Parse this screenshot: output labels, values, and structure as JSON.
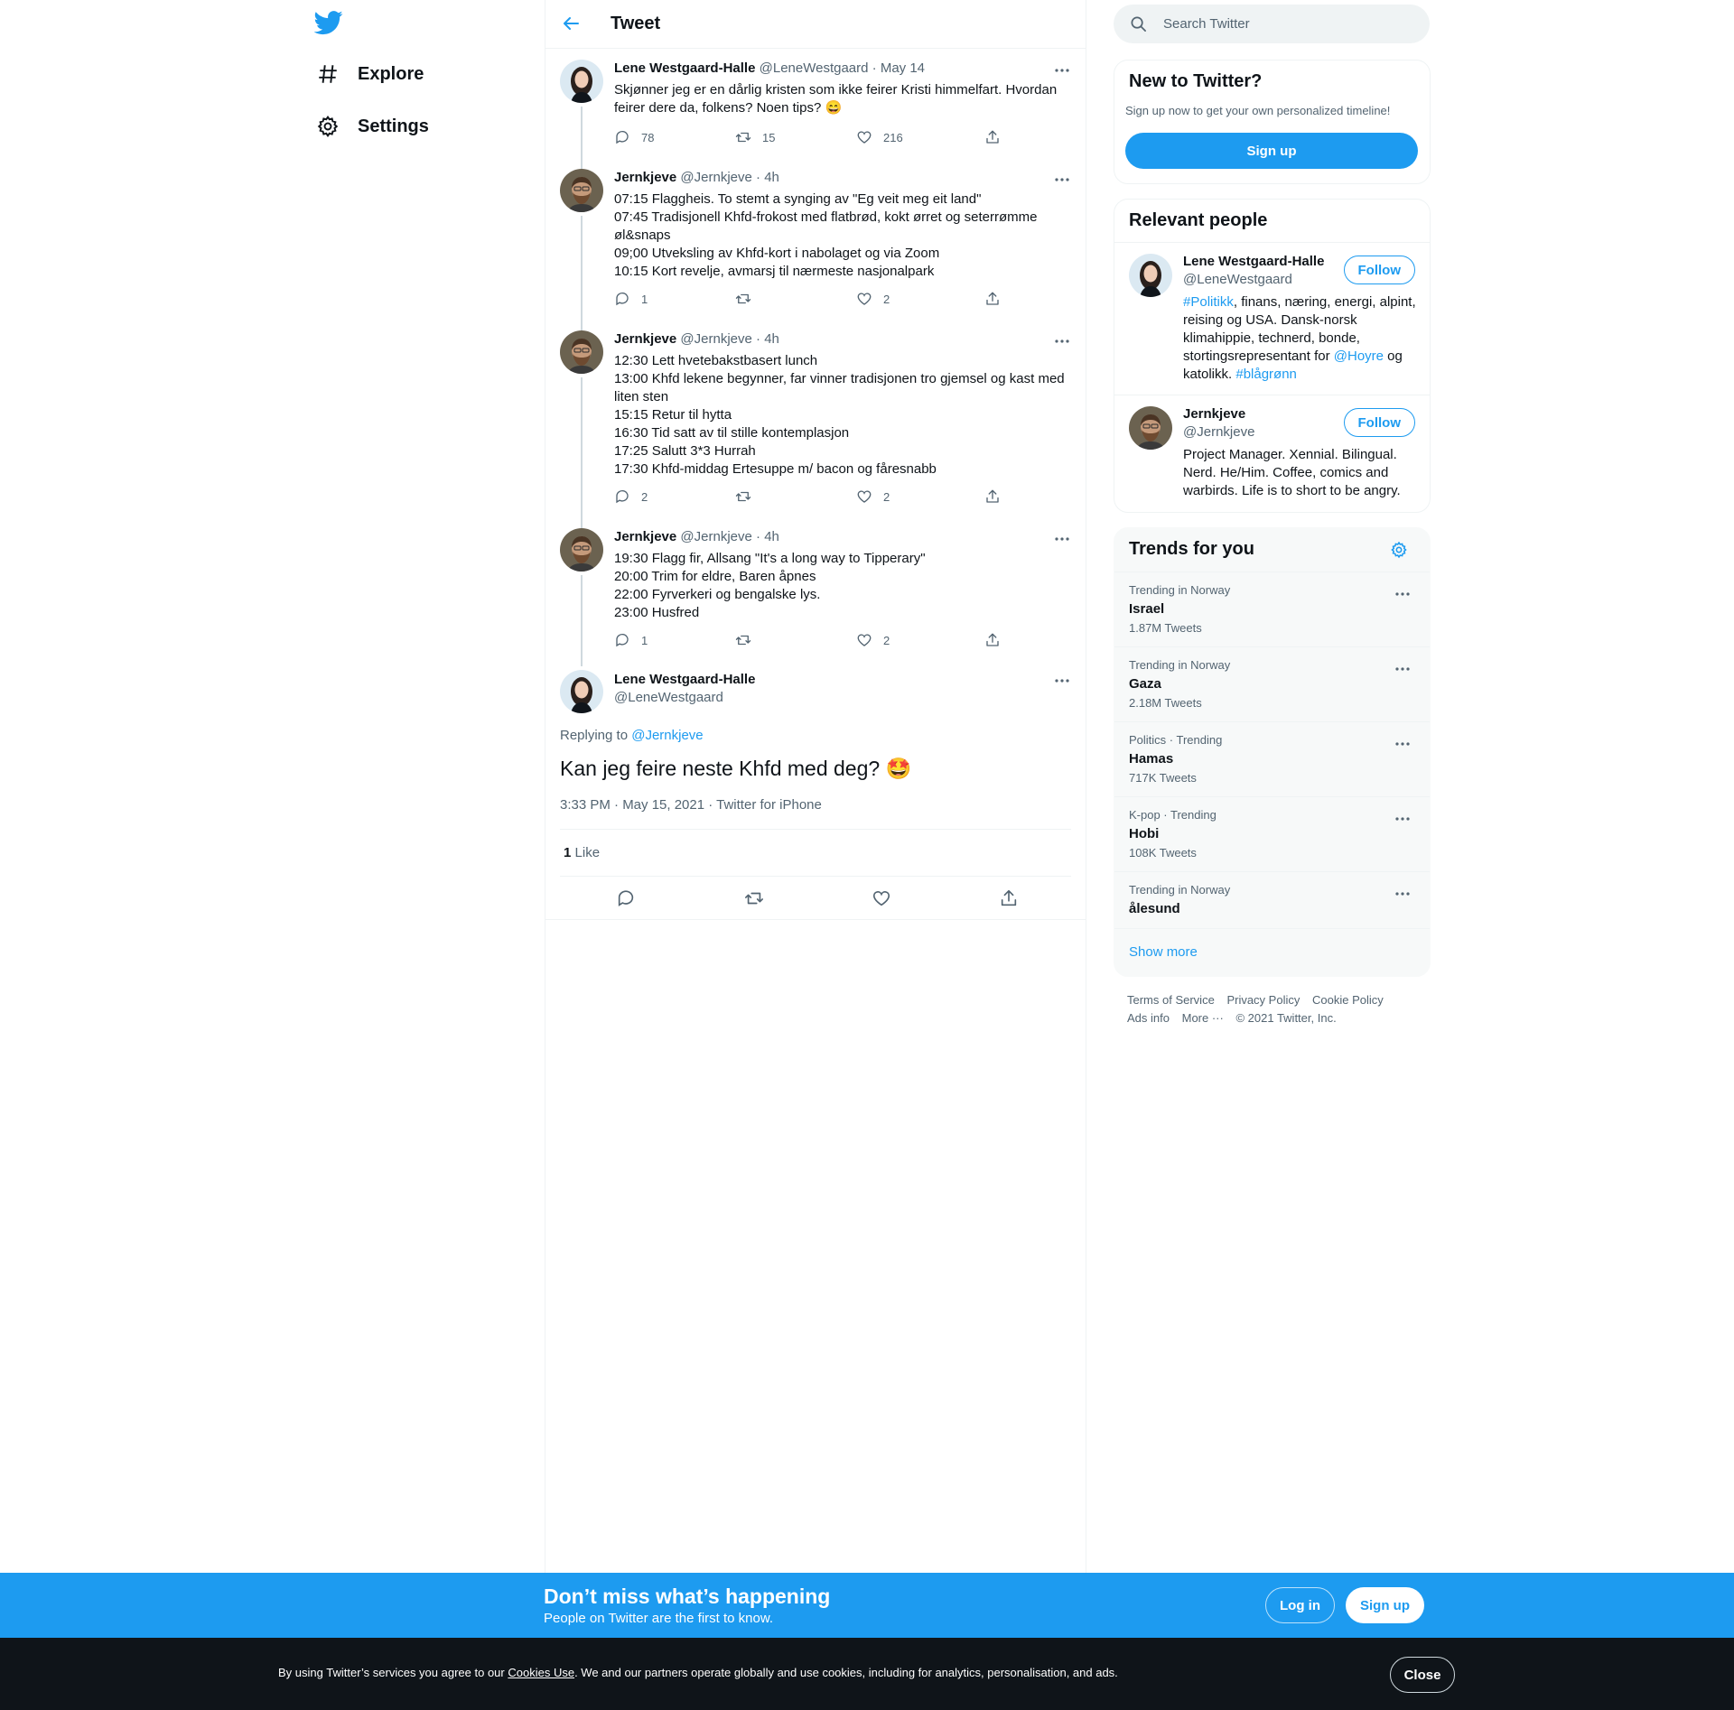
{
  "colors": {
    "brand": "#1d9bf0",
    "text": "#0f1419",
    "muted": "#536471",
    "border": "#eff3f4",
    "dark": "#0f1419"
  },
  "nav": {
    "logo_icon": "twitter-bird-icon",
    "items": [
      {
        "label": "Explore",
        "icon": "hashtag-icon"
      },
      {
        "label": "Settings",
        "icon": "gear-icon"
      }
    ]
  },
  "header": {
    "title": "Tweet",
    "back_icon": "arrow-left-icon"
  },
  "thread": [
    {
      "name": "Lene Westgaard-Halle",
      "handle": "@LeneWestgaard",
      "sep": "·",
      "time": "May 14",
      "text": "Skjønner jeg er en dårlig kristen som ikke feirer Kristi himmelfart. Hvordan feirer dere da, folkens? Noen tips? 😄",
      "replies": "78",
      "retweets": "15",
      "likes": "216"
    },
    {
      "name": "Jernkjeve",
      "handle": "@Jernkjeve",
      "sep": "·",
      "time": "4h",
      "lines": [
        "07:15 Flaggheis. To stemt a synging av \"Eg veit meg eit land\"",
        "07:45 Tradisjonell Khfd-frokost med flatbrød, kokt ørret og seterrømme øl&snaps",
        "09;00 Utveksling av Khfd-kort i nabolaget og via Zoom",
        "10:15 Kort revelje, avmarsj til nærmeste nasjonalpark"
      ],
      "replies": "1",
      "retweets": "",
      "likes": "2"
    },
    {
      "name": "Jernkjeve",
      "handle": "@Jernkjeve",
      "sep": "·",
      "time": "4h",
      "lines": [
        "12:30 Lett hvetebakstbasert lunch",
        "13:00 Khfd lekene begynner, far vinner tradisjonen tro gjemsel og kast med liten sten",
        "15:15 Retur til hytta",
        "16:30 Tid satt av til stille kontemplasjon",
        "17:25 Salutt 3*3 Hurrah",
        "17:30 Khfd-middag Ertesuppe m/ bacon og fåresnabb"
      ],
      "replies": "2",
      "retweets": "",
      "likes": "2"
    },
    {
      "name": "Jernkjeve",
      "handle": "@Jernkjeve",
      "sep": "·",
      "time": "4h",
      "lines": [
        "19:30 Flagg fir, Allsang \"It's a long way to Tipperary\"",
        "20:00 Trim for eldre, Baren åpnes",
        "22:00 Fyrverkeri og bengalske lys.",
        "23:00 Husfred"
      ],
      "replies": "1",
      "retweets": "",
      "likes": "2"
    }
  ],
  "focus": {
    "name": "Lene Westgaard-Halle",
    "handle": "@LeneWestgaard",
    "replying_prefix": "Replying to",
    "replying_to": "@Jernkjeve",
    "text": "Kan jeg feire neste Khfd med deg? 🤩",
    "meta": "3:33 PM · May 15, 2021 · Twitter for iPhone",
    "like_count": "1",
    "like_label": "Like"
  },
  "search": {
    "placeholder": "Search Twitter"
  },
  "new_to_twitter": {
    "title": "New to Twitter?",
    "subtitle": "Sign up now to get your own personalized timeline!",
    "button": "Sign up"
  },
  "relevant_people": {
    "title": "Relevant people",
    "people": [
      {
        "name": "Lene Westgaard-Halle",
        "handle": "@LeneWestgaard",
        "follow": "Follow",
        "bio_link1": "#Politikk",
        "bio_text1": ", finans, næring, energi, alpint, reising og USA. Dansk-norsk klimahippie, technerd, bonde, stortingsrepresentant for ",
        "bio_link2": "@Hoyre",
        "bio_text2": " og katolikk. ",
        "bio_link3": "#blågrønn"
      },
      {
        "name": "Jernkjeve",
        "handle": "@Jernkjeve",
        "follow": "Follow",
        "bio": "Project Manager. Xennial. Bilingual. Nerd. He/Him. Coffee, comics and warbirds. Life is to short to be angry."
      }
    ]
  },
  "trends": {
    "title": "Trends for you",
    "items": [
      {
        "context": "Trending in Norway",
        "name": "Israel",
        "count": "1.87M Tweets"
      },
      {
        "context": "Trending in Norway",
        "name": "Gaza",
        "count": "2.18M Tweets"
      },
      {
        "context": "Politics · Trending",
        "name": "Hamas",
        "count": "717K Tweets"
      },
      {
        "context": "K-pop · Trending",
        "name": "Hobi",
        "count": "108K Tweets"
      },
      {
        "context": "Trending in Norway",
        "name": "ålesund",
        "count": ""
      }
    ],
    "show_more": "Show more"
  },
  "footer": {
    "links": [
      "Terms of Service",
      "Privacy Policy",
      "Cookie Policy",
      "Ads info",
      "More ···"
    ],
    "copyright": "© 2021 Twitter, Inc."
  },
  "cta": {
    "title": "Don’t miss what’s happening",
    "subtitle": "People on Twitter are the first to know.",
    "login": "Log in",
    "signup": "Sign up"
  },
  "cookie": {
    "text_before": "By using Twitter’s services you agree to our ",
    "link": "Cookies Use",
    "text_after": ". We and our partners operate globally and use cookies, including for analytics, personalisation, and ads.",
    "close": "Close"
  }
}
